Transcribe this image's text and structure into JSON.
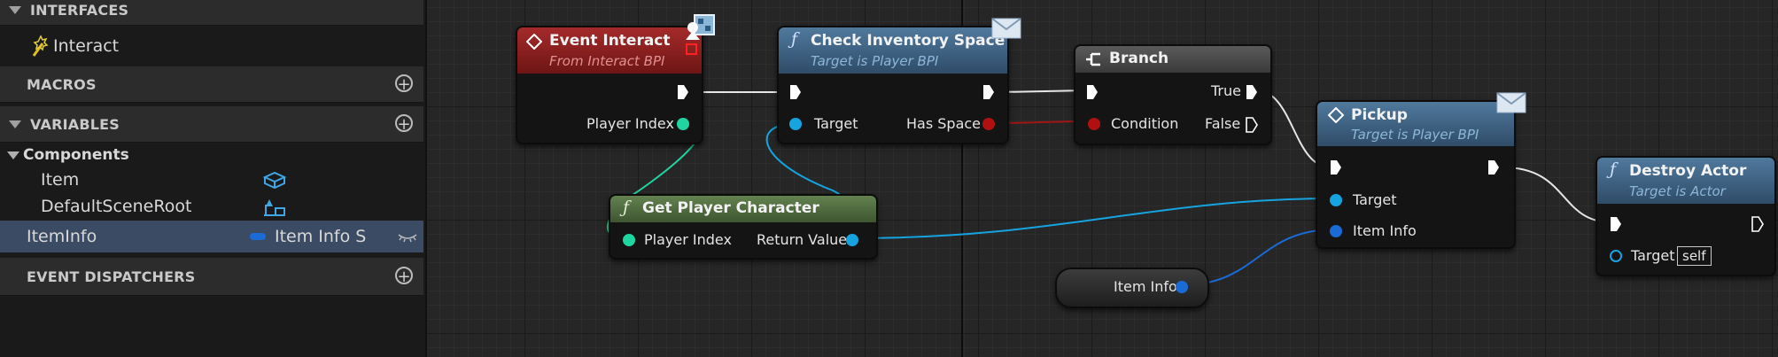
{
  "sidebar": {
    "interfaces": {
      "title": "INTERFACES",
      "items": [
        {
          "label": "Interact",
          "icon": "interface-function-icon"
        }
      ]
    },
    "macros": {
      "title": "MACROS"
    },
    "variables": {
      "title": "VARIABLES",
      "group": "Components",
      "components": [
        {
          "label": "Item",
          "icon": "static-mesh-icon"
        },
        {
          "label": "DefaultSceneRoot",
          "icon": "scene-root-icon"
        }
      ],
      "selected": {
        "label": "ItemInfo",
        "type": "Item Info S",
        "type_color": "#1a6bd6"
      }
    },
    "dispatchers": {
      "title": "EVENT DISPATCHERS"
    }
  },
  "nodes": {
    "event_interact": {
      "title": "Event Interact",
      "subtitle": "From Interact BPI",
      "pin_player_index": "Player Index",
      "color": "#8e1e1e"
    },
    "check_inventory": {
      "title": "Check Inventory Space",
      "subtitle": "Target is Player BPI",
      "pin_target": "Target",
      "pin_has_space": "Has Space",
      "color": "#3f6281"
    },
    "branch": {
      "title": "Branch",
      "pin_condition": "Condition",
      "pin_true": "True",
      "pin_false": "False",
      "color": "#4a4a4a"
    },
    "get_player": {
      "title": "Get Player Character",
      "pin_player_index": "Player Index",
      "pin_return": "Return Value",
      "color": "#4f6b3f"
    },
    "pickup": {
      "title": "Pickup",
      "subtitle": "Target is Player BPI",
      "pin_target": "Target",
      "pin_item_info": "Item Info",
      "color": "#3f6281"
    },
    "item_info_var": {
      "label": "Item Info"
    },
    "destroy_actor": {
      "title": "Destroy Actor",
      "subtitle": "Target is Actor",
      "pin_target": "Target",
      "self_value": "self",
      "color": "#3f6281"
    }
  },
  "colors": {
    "exec": "#ffffff",
    "int": "#1fd6a0",
    "object": "#15a4e0",
    "bool": "#b01010",
    "struct": "#1a6bd6"
  }
}
